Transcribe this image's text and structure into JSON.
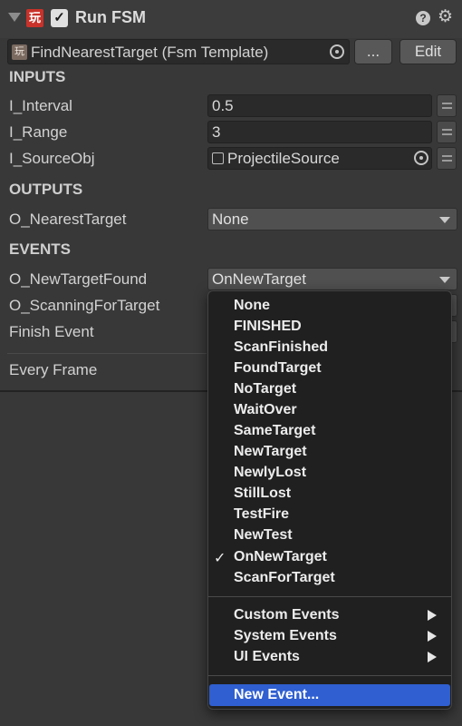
{
  "header": {
    "title": "Run FSM",
    "pm_icon_glyph": "玩",
    "enabled": true
  },
  "template": {
    "icon_glyph": "玩",
    "value": "FindNearestTarget (Fsm Template)",
    "more_label": "...",
    "edit_label": "Edit"
  },
  "sections": {
    "inputs": "INPUTS",
    "outputs": "OUTPUTS",
    "events": "EVENTS"
  },
  "inputs": {
    "interval": {
      "label": "I_Interval",
      "value": "0.5"
    },
    "range": {
      "label": "I_Range",
      "value": "3"
    },
    "source_obj": {
      "label": "I_SourceObj",
      "value": "ProjectileSource"
    }
  },
  "outputs": {
    "nearest_target": {
      "label": "O_NearestTarget",
      "value": "None"
    }
  },
  "events": {
    "new_target_found": {
      "label": "O_NewTargetFound",
      "value": "OnNewTarget"
    },
    "scanning_for_target": {
      "label": "O_ScanningForTarget"
    },
    "finish_event": {
      "label": "Finish Event"
    }
  },
  "every_frame": {
    "label": "Every Frame"
  },
  "event_menu": {
    "items": [
      "None",
      "FINISHED",
      "ScanFinished",
      "FoundTarget",
      "NoTarget",
      "WaitOver",
      "SameTarget",
      "NewTarget",
      "NewlyLost",
      "StillLost",
      "TestFire",
      "NewTest",
      "OnNewTarget",
      "ScanForTarget"
    ],
    "checked": "OnNewTarget",
    "check_glyph": "✓",
    "submenus": [
      "Custom Events",
      "System Events",
      "UI Events"
    ],
    "new_event": "New Event..."
  },
  "colors": {
    "background": "#383838",
    "field": "#2a2a2a",
    "menu_background": "#202020",
    "highlight": "#2f5fd0",
    "pm_icon": "#c8322a"
  }
}
